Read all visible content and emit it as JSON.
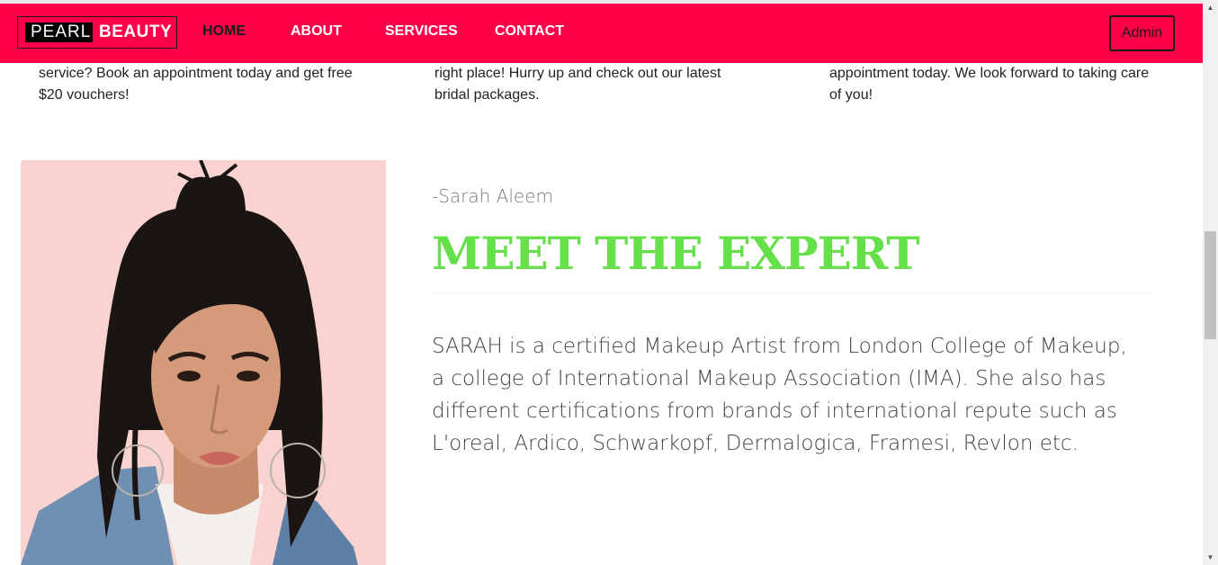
{
  "brand": {
    "part1": "PEARL",
    "part2": "BEAUTY"
  },
  "nav": {
    "home": "HOME",
    "about": "ABOUT",
    "services": "SERVICES",
    "contact": "CONTACT",
    "admin": "Admin"
  },
  "services": [
    {
      "line1": "service? Book an appointment today and get free",
      "line2": "$20 vouchers!"
    },
    {
      "line1": "right place! Hurry up and check out our latest",
      "line2": "bridal packages."
    },
    {
      "line1": "appointment today. We look forward to taking care",
      "line2": "of you!"
    }
  ],
  "expert": {
    "quote": "-Sarah Aleem",
    "heading": "MEET THE EXPERT",
    "bio_lines": [
      "SARAH is a certified Makeup Artist from London College of Makeup,",
      "a college of International Makeup Association (IMA). She also has",
      "different certifications from brands of international repute such as",
      "L'oreal, Ardico, Schwarkopf, Dermalogica, Framesi, Revlon etc."
    ]
  },
  "colors": {
    "navbar": "#ff0048",
    "heading": "#66e04a",
    "photo_background": "#f9d3d0"
  }
}
